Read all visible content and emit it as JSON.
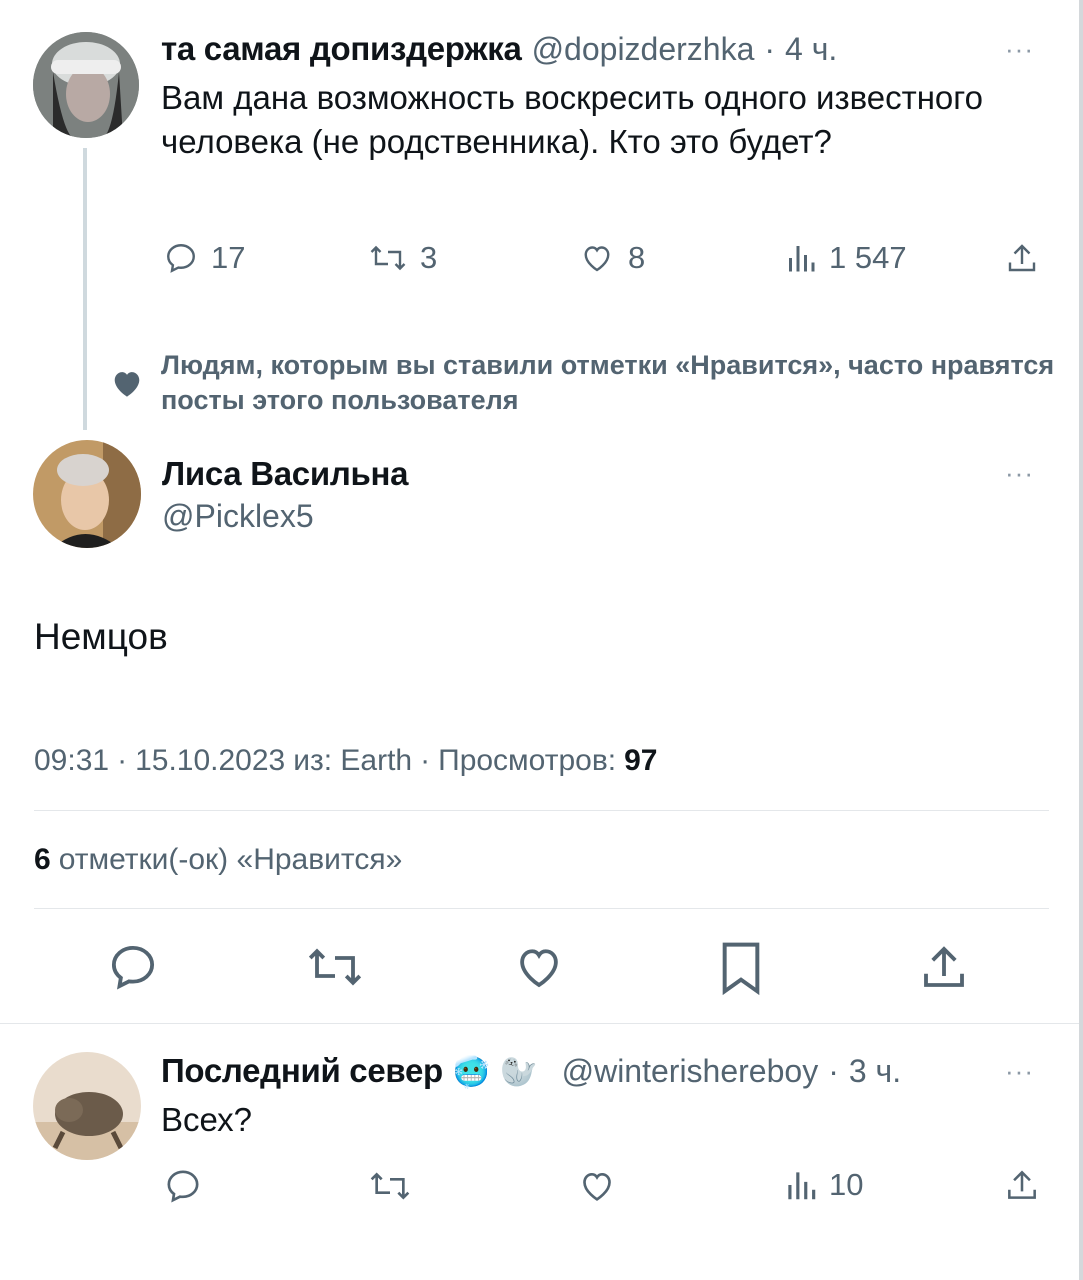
{
  "tweet1": {
    "author_name": "та самая допиздержка",
    "handle": "@dopizderzhka",
    "separator": "·",
    "time": "4 ч.",
    "more": "···",
    "text": "Вам дана возможность воскресить одного известного человека (не родственника). Кто это будет?",
    "replies": "17",
    "retweets": "3",
    "likes": "8",
    "views": "1 547"
  },
  "recommendation": {
    "text": "Людям, которым вы ставили отметки «Нравится», часто нравятся посты этого пользователя"
  },
  "main_tweet": {
    "author_name": "Лиса Васильна",
    "handle": "@Picklex5",
    "more": "···",
    "text": "Немцов",
    "meta_time": "09:31",
    "meta_sep1": "·",
    "meta_date": "15.10.2023",
    "meta_source": "из: Earth",
    "meta_sep2": "·",
    "meta_views_label": "Просмотров:",
    "meta_views_value": "97",
    "likes_count": "6",
    "likes_label": "отметки(-ок) «Нравится»"
  },
  "reply": {
    "author_name": "Последний север",
    "emoji1": "🥶",
    "emoji2": "🦭",
    "handle": "@winterishereboy",
    "separator": "·",
    "time": "3 ч.",
    "more": "···",
    "text": "Всех?",
    "views": "10"
  },
  "colors": {
    "text": "#0f1419",
    "muted": "#536471",
    "divider": "#e4e7ea",
    "thread_line": "#cfd9de"
  }
}
